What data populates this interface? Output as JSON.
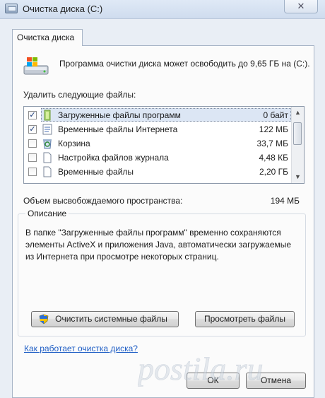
{
  "window": {
    "title": "Очистка диска  (C:)",
    "close_glyph": "✕"
  },
  "tab": {
    "label": "Очистка диска"
  },
  "header": {
    "text": "Программа очистки диска может освободить до 9,65 ГБ на  (C:)."
  },
  "files_label": "Удалить следующие файлы:",
  "files": [
    {
      "name": "Загруженные файлы программ",
      "size": "0 байт",
      "checked": true,
      "icon": "folder-icon"
    },
    {
      "name": "Временные файлы Интернета",
      "size": "122 МБ",
      "checked": true,
      "icon": "document-icon"
    },
    {
      "name": "Корзина",
      "size": "33,7 МБ",
      "checked": false,
      "icon": "recycle-bin-icon"
    },
    {
      "name": "Настройка файлов журнала",
      "size": "4,48 КБ",
      "checked": false,
      "icon": "blank-file-icon"
    },
    {
      "name": "Временные файлы",
      "size": "2,20 ГБ",
      "checked": false,
      "icon": "blank-file-icon"
    }
  ],
  "space": {
    "label": "Объем высвобождаемого пространства:",
    "value": "194 МБ"
  },
  "description": {
    "title": "Описание",
    "text": "В папке \"Загруженные файлы программ\" временно сохраняются элементы ActiveX и приложения Java, автоматически загружаемые из Интернета при просмотре некоторых страниц."
  },
  "buttons": {
    "clean_system": "Очистить системные файлы",
    "view_files": "Просмотреть файлы",
    "ok": "ОК",
    "cancel": "Отмена"
  },
  "help_link": "Как работает очистка диска?",
  "watermark": "postila.ru",
  "colors": {
    "link": "#1f5ec5",
    "selection": "#dce6f4",
    "titlebar": "#dfe9f6"
  }
}
